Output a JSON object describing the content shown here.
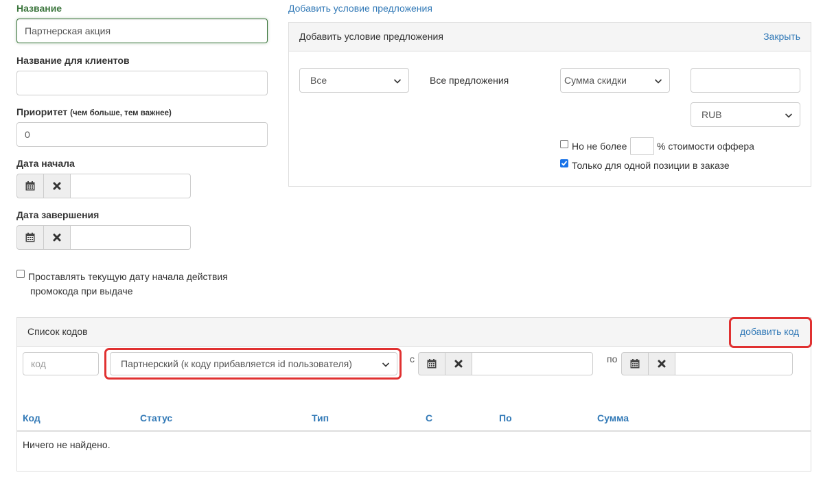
{
  "form": {
    "name_label": "Название",
    "name_value": "Партнерская акция",
    "client_name_label": "Название для клиентов",
    "client_name_value": "",
    "priority_label": "Приоритет",
    "priority_hint": "(чем больше, тем важнее)",
    "priority_value": "0",
    "start_date_label": "Дата начала",
    "end_date_label": "Дата завершения",
    "set_current_date_label_line1": "Проставлять текущую дату начала действия",
    "set_current_date_label_line2": "промокода при выдаче",
    "set_current_date_checked": false
  },
  "offer_condition": {
    "add_link": "Добавить условие предложения",
    "panel_title": "Добавить условие предложения",
    "close_link": "Закрыть",
    "scope_select": "Все",
    "all_offers_label": "Все предложения",
    "discount_type_select": "Сумма скидки",
    "amount_value": "",
    "currency_select": "RUB",
    "limit_checkbox_label": "Но не более",
    "limit_value": "",
    "limit_suffix": "% стоимости оффера",
    "limit_checked": false,
    "single_position_label": "Только для одной позиции в заказе",
    "single_position_checked": true
  },
  "codes": {
    "panel_title": "Список кодов",
    "add_code_link": "добавить код",
    "code_placeholder": "код",
    "code_type_select": "Партнерский (к коду прибавляется id пользователя)",
    "from_label": "с",
    "to_label": "по",
    "table_headers": [
      "Код",
      "Статус",
      "Тип",
      "С",
      "По",
      "Сумма"
    ],
    "empty_message": "Ничего не найдено."
  },
  "colors": {
    "accent_link": "#337ab7",
    "success_label": "#3c763d",
    "highlight": "#e03131",
    "checkbox_checked": "#1a73e8"
  },
  "icons": {
    "calendar": "calendar-icon",
    "clear": "times-icon",
    "dropdown": "chevron-down-icon"
  }
}
